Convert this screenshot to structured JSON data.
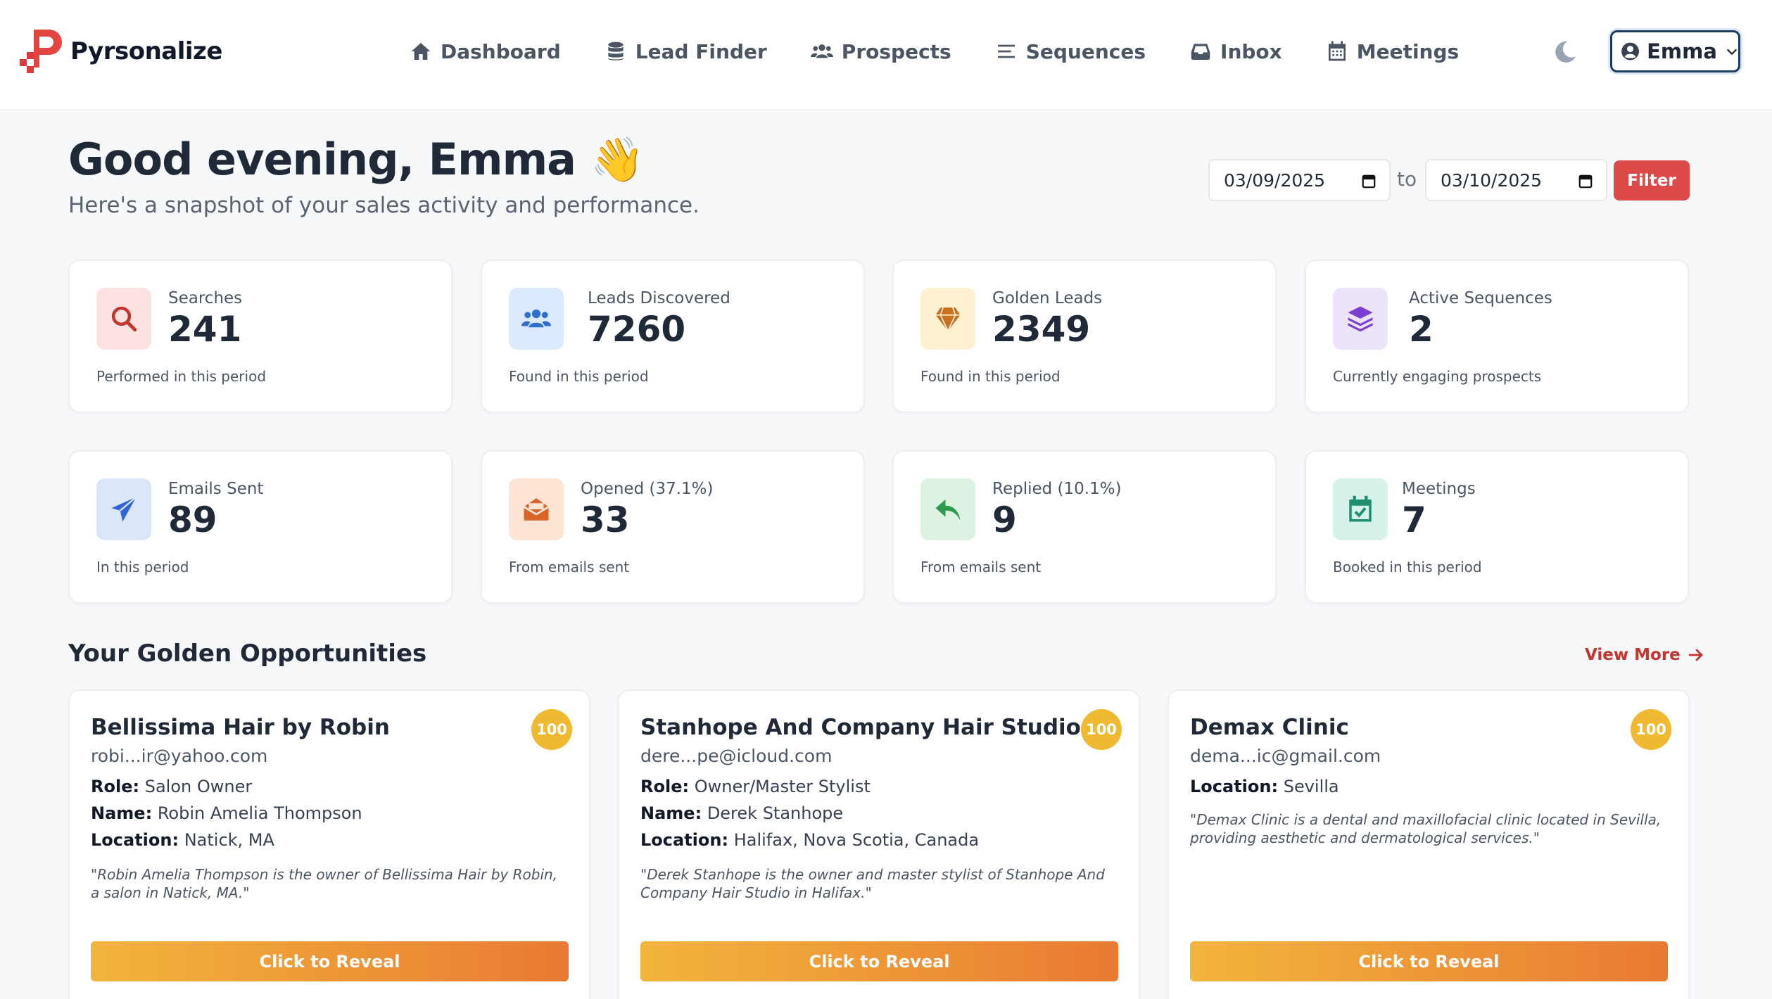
{
  "brand": {
    "name": "Pyrsonalize",
    "accent": "#dc4a4a"
  },
  "nav": {
    "items": [
      {
        "label": "Dashboard",
        "icon": "home-icon"
      },
      {
        "label": "Lead Finder",
        "icon": "database-icon"
      },
      {
        "label": "Prospects",
        "icon": "users-icon"
      },
      {
        "label": "Sequences",
        "icon": "list-icon"
      },
      {
        "label": "Inbox",
        "icon": "inbox-icon"
      },
      {
        "label": "Meetings",
        "icon": "calendar-icon"
      }
    ]
  },
  "user": {
    "name": "Emma"
  },
  "header": {
    "greeting": "Good evening, Emma",
    "emoji": "👋",
    "subtitle": "Here's a snapshot of your sales activity and performance."
  },
  "filter": {
    "from": "03/09/2025",
    "to_label": "to",
    "to": "03/10/2025",
    "button": "Filter"
  },
  "stats": [
    {
      "label": "Searches",
      "value": "241",
      "foot": "Performed in this period",
      "icon": "search-icon"
    },
    {
      "label": "Leads Discovered",
      "value": "7260",
      "foot": "Found in this period",
      "icon": "users-icon"
    },
    {
      "label": "Golden Leads",
      "value": "2349",
      "foot": "Found in this period",
      "icon": "gem-icon"
    },
    {
      "label": "Active Sequences",
      "value": "2",
      "foot": "Currently engaging prospects",
      "icon": "layers-icon"
    },
    {
      "label": "Emails Sent",
      "value": "89",
      "foot": "In this period",
      "icon": "paper-plane-icon"
    },
    {
      "label": "Opened (37.1%)",
      "value": "33",
      "foot": "From emails sent",
      "icon": "envelope-open-icon"
    },
    {
      "label": "Replied (10.1%)",
      "value": "9",
      "foot": "From emails sent",
      "icon": "reply-icon"
    },
    {
      "label": "Meetings",
      "value": "7",
      "foot": "Booked in this period",
      "icon": "calendar-check-icon"
    }
  ],
  "opportunities": {
    "title": "Your Golden Opportunities",
    "view_more": "View More",
    "cards": [
      {
        "name": "Bellissima Hair by Robin",
        "score": "100",
        "email": "robi...ir@yahoo.com",
        "role_label": "Role:",
        "role": "Salon Owner",
        "name_label": "Name:",
        "person": "Robin Amelia Thompson",
        "location_label": "Location:",
        "location": "Natick, MA",
        "quote": "\"Robin Amelia Thompson is the owner of Bellissima Hair by Robin, a salon in Natick, MA.\"",
        "button": "Click to Reveal"
      },
      {
        "name": "Stanhope And Company Hair Studio",
        "score": "100",
        "email": "dere...pe@icloud.com",
        "role_label": "Role:",
        "role": "Owner/Master Stylist",
        "name_label": "Name:",
        "person": "Derek Stanhope",
        "location_label": "Location:",
        "location": "Halifax, Nova Scotia, Canada",
        "quote": "\"Derek Stanhope is the owner and master stylist of Stanhope And Company Hair Studio in Halifax.\"",
        "button": "Click to Reveal"
      },
      {
        "name": "Demax Clinic",
        "score": "100",
        "email": "dema...ic@gmail.com",
        "location_label": "Location:",
        "location": "Sevilla",
        "quote": "\"Demax Clinic is a dental and maxillofacial clinic located in Sevilla, providing aesthetic and dermatological services.\"",
        "button": "Click to Reveal"
      }
    ]
  }
}
